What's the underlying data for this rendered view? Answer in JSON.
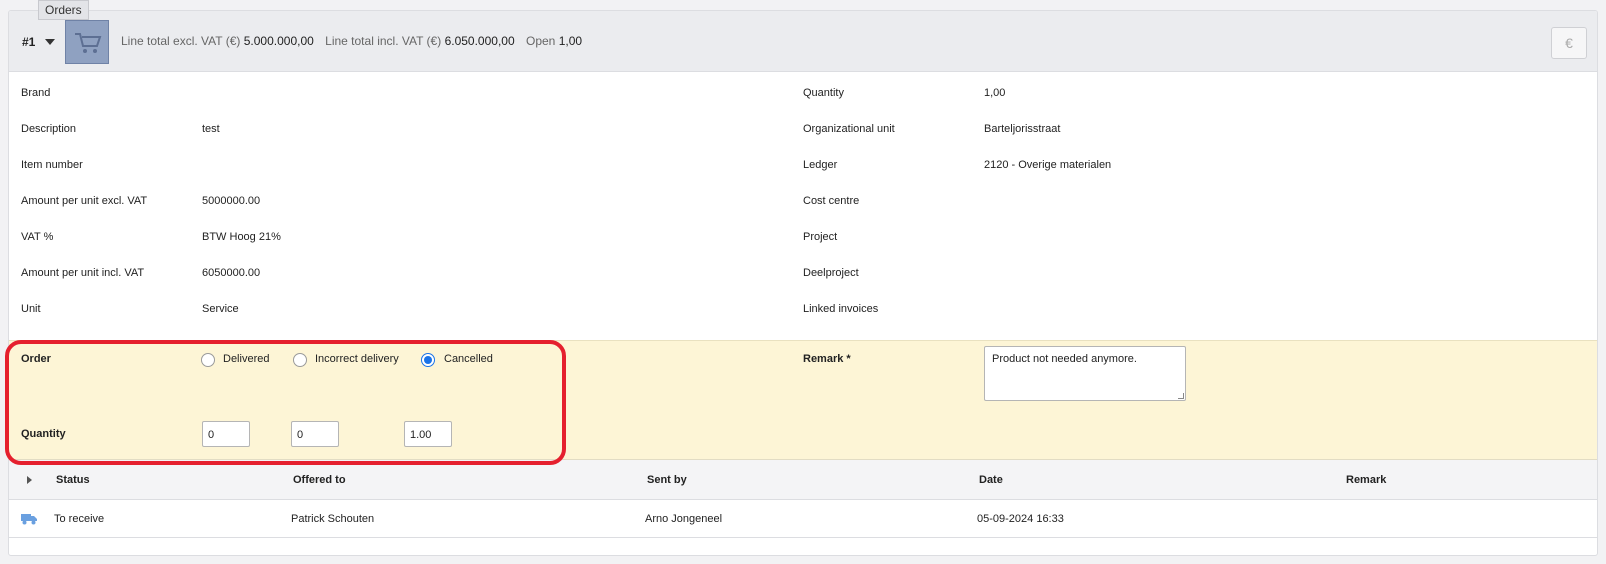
{
  "header": {
    "line_number": "#1",
    "tooltip": "Orders",
    "line_total_excl_label": "Line total excl. VAT (€)",
    "line_total_excl_value": "5.000.000,00",
    "line_total_incl_label": "Line total incl. VAT (€)",
    "line_total_incl_value": "6.050.000,00",
    "open_label": "Open",
    "open_value": "1,00",
    "euro_button": "€",
    "thumb_icon": "shopping-cart-icon"
  },
  "details_left": [
    {
      "label": "Brand",
      "value": ""
    },
    {
      "label": "Description",
      "value": "test"
    },
    {
      "label": "Item number",
      "value": ""
    },
    {
      "label": "Amount per unit excl. VAT",
      "value": "5000000.00"
    },
    {
      "label": "VAT %",
      "value": "BTW Hoog 21%"
    },
    {
      "label": "Amount per unit incl. VAT",
      "value": "6050000.00"
    },
    {
      "label": "Unit",
      "value": "Service"
    }
  ],
  "details_right": [
    {
      "label": "Quantity",
      "value": "1,00"
    },
    {
      "label": "Organizational unit",
      "value": "Barteljorisstraat"
    },
    {
      "label": "Ledger",
      "value": "2120 - Overige materialen"
    },
    {
      "label": "Cost centre",
      "value": ""
    },
    {
      "label": "Project",
      "value": ""
    },
    {
      "label": "Deelproject",
      "value": ""
    },
    {
      "label": "Linked invoices",
      "value": ""
    }
  ],
  "order": {
    "label": "Order",
    "options": [
      {
        "label": "Delivered",
        "checked": false
      },
      {
        "label": "Incorrect delivery",
        "checked": false
      },
      {
        "label": "Cancelled",
        "checked": true
      }
    ],
    "quantity_label": "Quantity",
    "quantities": [
      "0",
      "0",
      "1.00"
    ],
    "remark_label": "Remark *",
    "remark_value": "Product not needed anymore."
  },
  "history": {
    "columns": [
      "Status",
      "Offered to",
      "Sent by",
      "Date",
      "Remark"
    ],
    "rows": [
      {
        "icon": "truck-icon",
        "status": "To receive",
        "offered_to": "Patrick Schouten",
        "sent_by": "Arno Jongeneel",
        "date": "05-09-2024 16:33",
        "remark": ""
      }
    ]
  },
  "colors": {
    "highlight": "#e5202e",
    "order_section_bg": "#fdf5d6",
    "radio_checked": "#1a73e8"
  }
}
